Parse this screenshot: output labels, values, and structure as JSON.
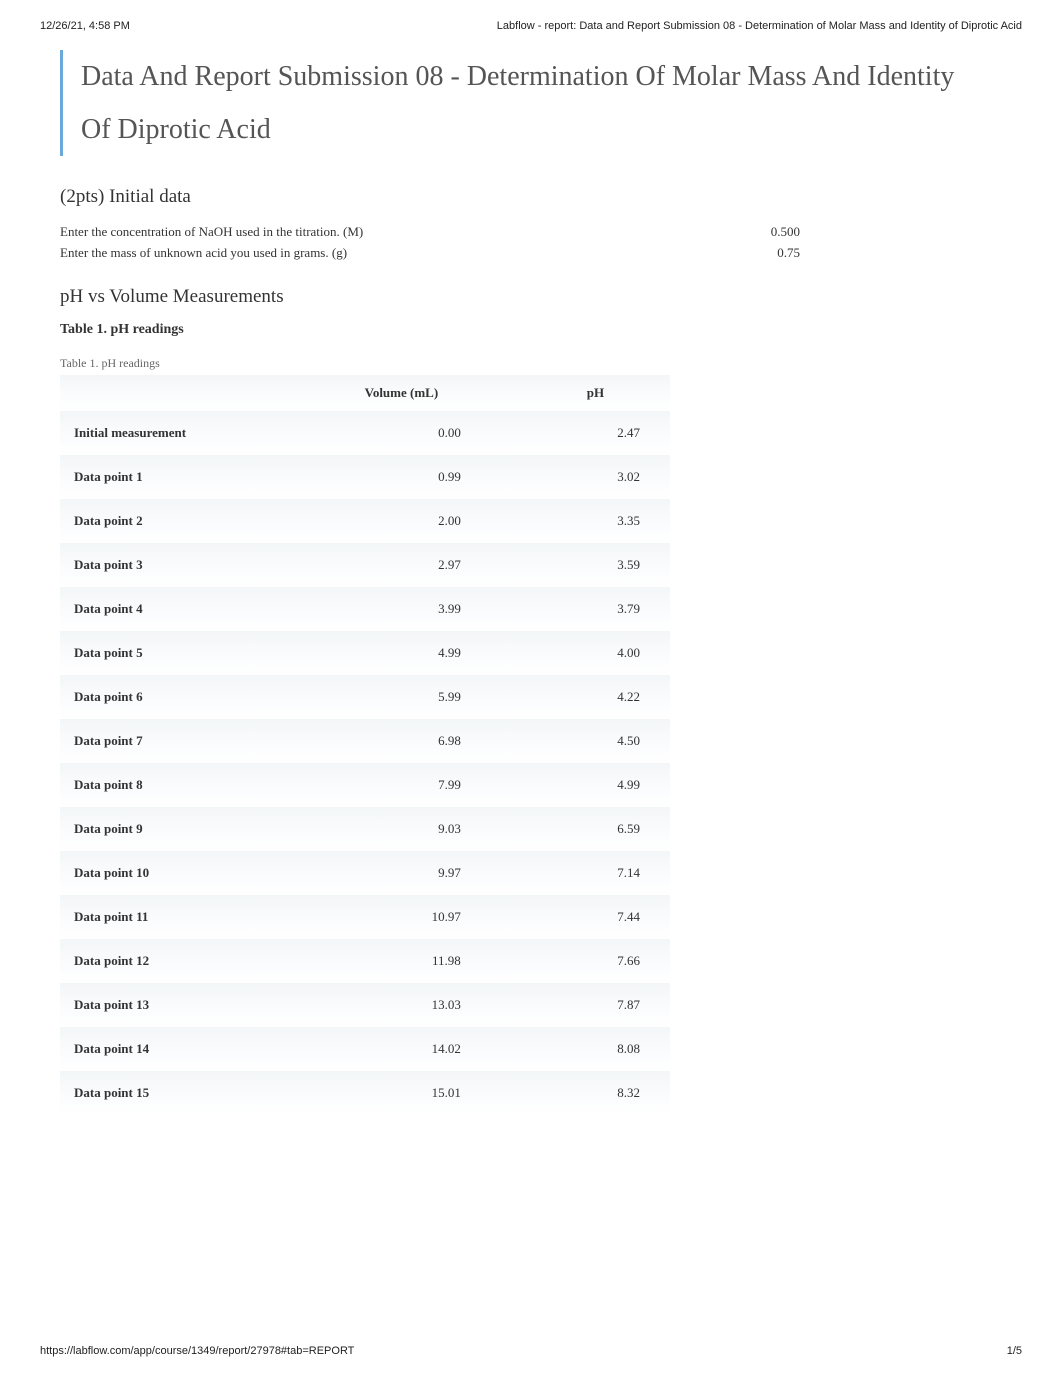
{
  "print": {
    "datetime": "12/26/21, 4:58 PM",
    "header_title": "Labflow - report: Data and Report Submission 08 - Determination of Molar Mass and Identity of Diprotic Acid",
    "footer_url": "https://labflow.com/app/course/1349/report/27978#tab=REPORT",
    "page_indicator": "1/5"
  },
  "title": "Data And Report Submission 08 - Determination Of Molar Mass And Identity Of Diprotic Acid",
  "sections": {
    "initial": {
      "heading": "(2pts) Initial data",
      "rows": [
        {
          "label": "Enter the concentration of NaOH used in the titration. (M)",
          "value": "0.500"
        },
        {
          "label": "Enter the mass of unknown acid you used in grams. (g)",
          "value": "0.75"
        }
      ]
    },
    "measurements": {
      "heading": "pH vs Volume Measurements",
      "table_title": "Table 1. pH readings",
      "caption": "Table 1. pH readings",
      "headers": {
        "col0": "",
        "col1": "Volume (mL)",
        "col2": "pH"
      },
      "rows": [
        {
          "label": "Initial measurement",
          "volume": "0.00",
          "ph": "2.47"
        },
        {
          "label": "Data point 1",
          "volume": "0.99",
          "ph": "3.02"
        },
        {
          "label": "Data point 2",
          "volume": "2.00",
          "ph": "3.35"
        },
        {
          "label": "Data point 3",
          "volume": "2.97",
          "ph": "3.59"
        },
        {
          "label": "Data point 4",
          "volume": "3.99",
          "ph": "3.79"
        },
        {
          "label": "Data point 5",
          "volume": "4.99",
          "ph": "4.00"
        },
        {
          "label": "Data point 6",
          "volume": "5.99",
          "ph": "4.22"
        },
        {
          "label": "Data point 7",
          "volume": "6.98",
          "ph": "4.50"
        },
        {
          "label": "Data point 8",
          "volume": "7.99",
          "ph": "4.99"
        },
        {
          "label": "Data point 9",
          "volume": "9.03",
          "ph": "6.59"
        },
        {
          "label": "Data point 10",
          "volume": "9.97",
          "ph": "7.14"
        },
        {
          "label": "Data point 11",
          "volume": "10.97",
          "ph": "7.44"
        },
        {
          "label": "Data point 12",
          "volume": "11.98",
          "ph": "7.66"
        },
        {
          "label": "Data point 13",
          "volume": "13.03",
          "ph": "7.87"
        },
        {
          "label": "Data point 14",
          "volume": "14.02",
          "ph": "8.08"
        },
        {
          "label": "Data point 15",
          "volume": "15.01",
          "ph": "8.32"
        }
      ]
    }
  }
}
